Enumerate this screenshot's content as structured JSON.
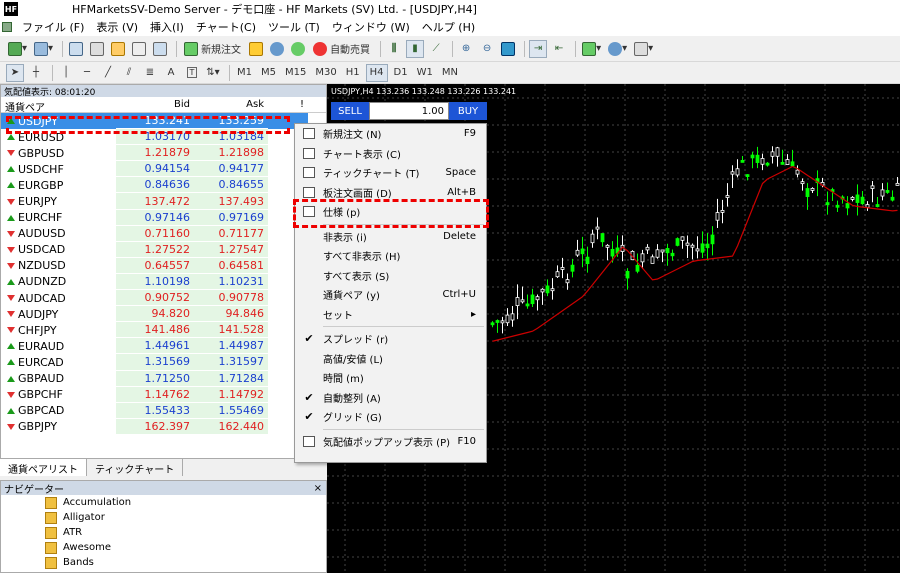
{
  "window": {
    "title": "HFMarketsSV-Demo Server - デモ口座 - HF Markets (SV) Ltd. - [USDJPY,H4]",
    "logo": "HF"
  },
  "menu": [
    "ファイル (F)",
    "表示 (V)",
    "挿入(I)",
    "チャート(C)",
    "ツール (T)",
    "ウィンドウ (W)",
    "ヘルプ (H)"
  ],
  "toolbar": {
    "new_order": "新規注文",
    "auto_trade": "自動売買"
  },
  "timeframes": [
    "M1",
    "M5",
    "M15",
    "M30",
    "H1",
    "H4",
    "D1",
    "W1",
    "MN"
  ],
  "timeframe_selected": "H4",
  "market_watch": {
    "title": "気配値表示: 08:01:20",
    "columns": {
      "symbol": "通貨ペア",
      "bid": "Bid",
      "ask": "Ask",
      "extra": "!"
    },
    "rows": [
      {
        "symbol": "USDJPY",
        "bid": "133.241",
        "ask": "133.259",
        "dir": "up",
        "bid_color": "blue",
        "ask_color": "blue"
      },
      {
        "symbol": "EURUSD",
        "bid": "1.03170",
        "ask": "1.03184",
        "dir": "up",
        "bid_color": "blue",
        "ask_color": "blue"
      },
      {
        "symbol": "GBPUSD",
        "bid": "1.21879",
        "ask": "1.21898",
        "dir": "down",
        "bid_color": "red",
        "ask_color": "red"
      },
      {
        "symbol": "USDCHF",
        "bid": "0.94154",
        "ask": "0.94177",
        "dir": "up",
        "bid_color": "blue",
        "ask_color": "blue"
      },
      {
        "symbol": "EURGBP",
        "bid": "0.84636",
        "ask": "0.84655",
        "dir": "up",
        "bid_color": "blue",
        "ask_color": "blue"
      },
      {
        "symbol": "EURJPY",
        "bid": "137.472",
        "ask": "137.493",
        "dir": "down",
        "bid_color": "red",
        "ask_color": "red"
      },
      {
        "symbol": "EURCHF",
        "bid": "0.97146",
        "ask": "0.97169",
        "dir": "up",
        "bid_color": "blue",
        "ask_color": "blue"
      },
      {
        "symbol": "AUDUSD",
        "bid": "0.71160",
        "ask": "0.71177",
        "dir": "down",
        "bid_color": "red",
        "ask_color": "red"
      },
      {
        "symbol": "USDCAD",
        "bid": "1.27522",
        "ask": "1.27547",
        "dir": "down",
        "bid_color": "red",
        "ask_color": "red"
      },
      {
        "symbol": "NZDUSD",
        "bid": "0.64557",
        "ask": "0.64581",
        "dir": "down",
        "bid_color": "red",
        "ask_color": "red"
      },
      {
        "symbol": "AUDNZD",
        "bid": "1.10198",
        "ask": "1.10231",
        "dir": "up",
        "bid_color": "blue",
        "ask_color": "blue"
      },
      {
        "symbol": "AUDCAD",
        "bid": "0.90752",
        "ask": "0.90778",
        "dir": "down",
        "bid_color": "red",
        "ask_color": "red"
      },
      {
        "symbol": "AUDJPY",
        "bid": "94.820",
        "ask": "94.846",
        "dir": "down",
        "bid_color": "red",
        "ask_color": "red"
      },
      {
        "symbol": "CHFJPY",
        "bid": "141.486",
        "ask": "141.528",
        "dir": "down",
        "bid_color": "red",
        "ask_color": "red"
      },
      {
        "symbol": "EURAUD",
        "bid": "1.44961",
        "ask": "1.44987",
        "dir": "up",
        "bid_color": "blue",
        "ask_color": "blue"
      },
      {
        "symbol": "EURCAD",
        "bid": "1.31569",
        "ask": "1.31597",
        "dir": "up",
        "bid_color": "blue",
        "ask_color": "blue"
      },
      {
        "symbol": "GBPAUD",
        "bid": "1.71250",
        "ask": "1.71284",
        "dir": "up",
        "bid_color": "blue",
        "ask_color": "blue"
      },
      {
        "symbol": "GBPCHF",
        "bid": "1.14762",
        "ask": "1.14792",
        "dir": "down",
        "bid_color": "red",
        "ask_color": "red"
      },
      {
        "symbol": "GBPCAD",
        "bid": "1.55433",
        "ask": "1.55469",
        "dir": "up",
        "bid_color": "blue",
        "ask_color": "blue"
      },
      {
        "symbol": "GBPJPY",
        "bid": "162.397",
        "ask": "162.440",
        "dir": "down",
        "bid_color": "red",
        "ask_color": "red"
      }
    ],
    "tabs": [
      "通貨ペアリスト",
      "ティックチャート"
    ]
  },
  "navigator": {
    "title": "ナビゲーター",
    "close": "×",
    "items": [
      "Accumulation",
      "Alligator",
      "ATR",
      "Awesome",
      "Bands"
    ]
  },
  "chart": {
    "info": "USDJPY,H4  133.236 133.248 133.226 133.241",
    "sell_label": "SELL",
    "buy_label": "BUY",
    "lot": "1.00"
  },
  "context_menu": {
    "items": [
      {
        "label": "新規注文 (N)",
        "shortcut": "F9",
        "icon": "new-order-icon"
      },
      {
        "label": "チャート表示 (C)",
        "shortcut": "",
        "icon": "chart-window-icon"
      },
      {
        "label": "ティックチャート (T)",
        "shortcut": "Space",
        "icon": "tick-chart-icon"
      },
      {
        "label": "板注文画面 (D)",
        "shortcut": "Alt+B",
        "icon": "depth-of-market-icon"
      },
      {
        "label": "仕様 (p)",
        "shortcut": "",
        "icon": "specification-icon"
      },
      {
        "sep": true
      },
      {
        "label": "非表示 (i)",
        "shortcut": "Delete",
        "icon": ""
      },
      {
        "label": "すべて非表示 (H)",
        "shortcut": "",
        "icon": ""
      },
      {
        "label": "すべて表示 (S)",
        "shortcut": "",
        "icon": ""
      },
      {
        "label": "通貨ペア (y)",
        "shortcut": "Ctrl+U",
        "icon": ""
      },
      {
        "label": "セット",
        "shortcut": "▸",
        "icon": ""
      },
      {
        "sep": true
      },
      {
        "label": "スプレッド (r)",
        "shortcut": "",
        "icon": "check-icon"
      },
      {
        "label": "高値/安値 (L)",
        "shortcut": "",
        "icon": ""
      },
      {
        "label": "時間 (m)",
        "shortcut": "",
        "icon": ""
      },
      {
        "label": "自動整列 (A)",
        "shortcut": "",
        "icon": "check-icon"
      },
      {
        "label": "グリッド (G)",
        "shortcut": "",
        "icon": "check-icon"
      },
      {
        "sep": true
      },
      {
        "label": "気配値ポップアップ表示 (P)",
        "shortcut": "F10",
        "icon": "popup-prices-icon"
      }
    ]
  },
  "colors": {
    "bull_candle": "#00ff00",
    "bear_candle": "#ffffff",
    "ma_line": "#cc0000",
    "grid": "#444444",
    "highlight": "#e00000"
  }
}
